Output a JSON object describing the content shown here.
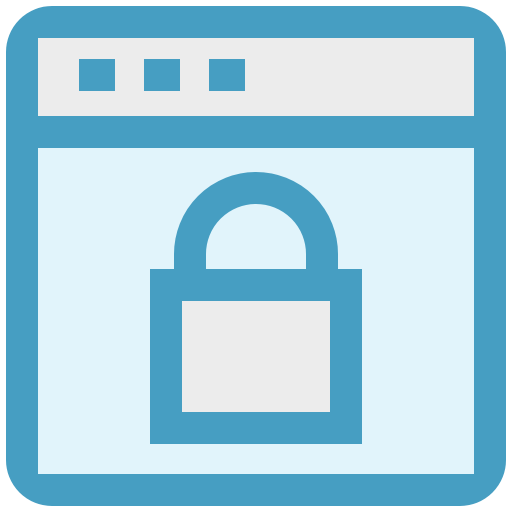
{
  "icon": {
    "name": "secure-browser-lock-icon",
    "parts": [
      "browser-window-icon",
      "window-dots-icon",
      "padlock-icon"
    ]
  },
  "colors": {
    "stroke": "#469ec2",
    "titlebar_fill": "#ececec",
    "content_fill": "#e1f4fb",
    "lock_body_fill": "#ececec",
    "background": "#ffffff"
  }
}
